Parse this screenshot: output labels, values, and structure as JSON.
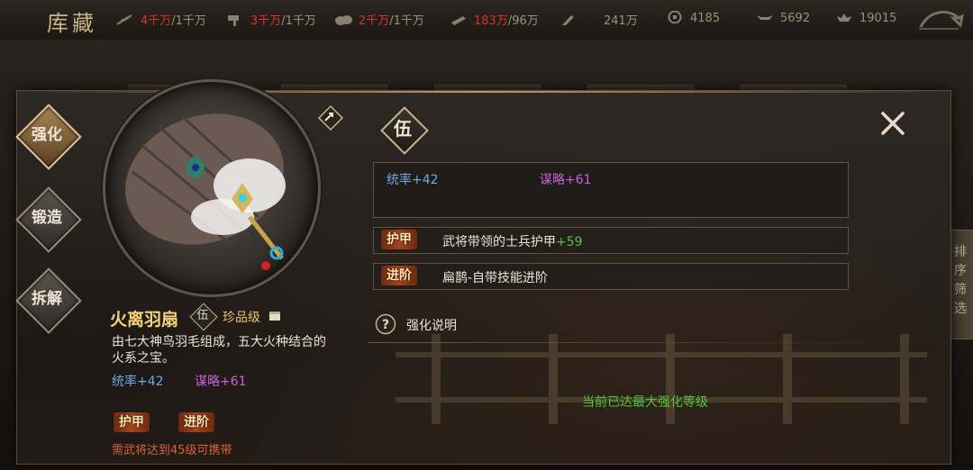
{
  "topbar": {
    "title": "库藏",
    "resources": [
      {
        "icon": "feather-icon",
        "current": "4千万",
        "max": "/1千万",
        "over": true
      },
      {
        "icon": "hammer-icon",
        "current": "3千万",
        "max": "/1千万",
        "over": true
      },
      {
        "icon": "cloud-icon",
        "current": "2千万",
        "max": "/1千万",
        "over": true
      },
      {
        "icon": "scroll-icon",
        "current": "183万",
        "max": "/96万",
        "over": true
      },
      {
        "icon": "blade-icon",
        "current": "241万",
        "max": "",
        "over": false
      },
      {
        "icon": "coin-icon",
        "current": "4185",
        "max": "",
        "over": false
      },
      {
        "icon": "ingot-icon",
        "current": "5692",
        "max": "",
        "over": false
      },
      {
        "icon": "treasure-icon",
        "current": "19015",
        "max": "",
        "over": false
      }
    ]
  },
  "shelf": {
    "card_label": "珍品",
    "side_label": "排序筛选"
  },
  "tabs": [
    {
      "label": "强化",
      "active": true
    },
    {
      "label": "锻造",
      "active": false
    },
    {
      "label": "拆解",
      "active": false
    }
  ],
  "item": {
    "name": "火离羽扇",
    "tier": "伍",
    "grade": "珍品级",
    "description": "由七大神鸟羽毛组成，五大火种结合的火系之宝。",
    "stat1": "统率+42",
    "stat2": "谋略+61",
    "tag1": "护甲",
    "tag2": "进阶",
    "requirement": "需武将达到45级可携带"
  },
  "detail": {
    "tier": "伍",
    "stat1": "统率+42",
    "stat2": "谋略+61",
    "rows": [
      {
        "tag": "护甲",
        "text": "武将带领的士兵护甲",
        "value": "+59"
      },
      {
        "tag": "进阶",
        "text": "扁鹊-自带技能进阶",
        "value": ""
      }
    ],
    "help_label": "强化说明",
    "max_level_text": "当前已达最大强化等级"
  },
  "colors": {
    "gold": "#f6d276",
    "blue_stat": "#6fa9e6",
    "purple_stat": "#c264e0",
    "green": "#52c43e",
    "red": "#d8352a"
  }
}
